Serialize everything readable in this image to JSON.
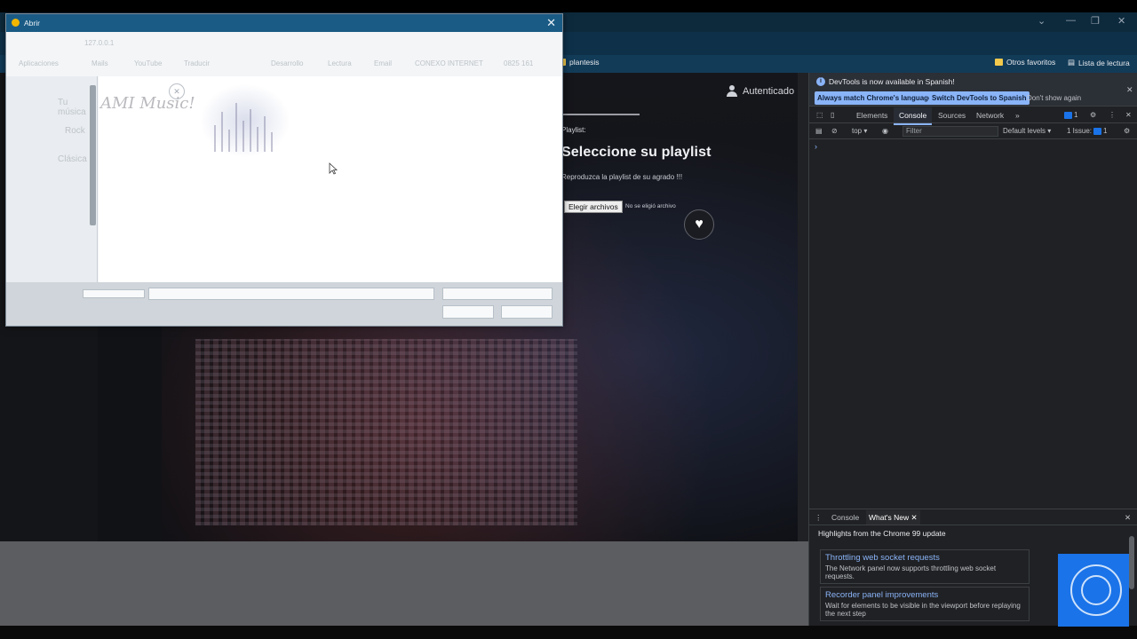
{
  "window": {
    "controls": {
      "minimize": "—",
      "restore": "❐",
      "close": "✕",
      "tab_search": "⌄"
    }
  },
  "bookmarks": {
    "items": [
      {
        "label": "Aplicaciones"
      },
      {
        "label": "Mails"
      },
      {
        "label": "YouTube"
      },
      {
        "label": "Traducir"
      },
      {
        "label": "Desarrollo"
      },
      {
        "label": "Lectura"
      },
      {
        "label": "Email"
      },
      {
        "label": "CONEXO INTERNET"
      },
      {
        "label": "0825 161"
      },
      {
        "label": "plantesis"
      }
    ],
    "right_items": [
      {
        "label": "Otros favoritos"
      },
      {
        "label": "Lista de lectura"
      }
    ]
  },
  "address_bar": {
    "url_text": "127.0.0.1"
  },
  "page": {
    "auth_label": "Autenticado",
    "playlist_label": "Playlist:",
    "title": "Seleccione su playlist",
    "subtitle": "Reproduzca la playlist de su agrado !!!",
    "file_button": "Elegir archivos",
    "file_status": "No se eligió archivo",
    "heart_glyph": "♥"
  },
  "dialog": {
    "title": "Abrir",
    "close_glyph": "✕",
    "logo_text": "AMI Music!",
    "ghost_sidebar": [
      "Tu música",
      "Rock",
      "Clásica"
    ]
  },
  "devtools": {
    "info_text": "DevTools is now available in Spanish!",
    "btn_match": "Always match Chrome's language",
    "btn_switch": "Switch DevTools to Spanish",
    "btn_dont": "Don't show again",
    "tabs": [
      "Elements",
      "Console",
      "Sources",
      "Network"
    ],
    "active_tab": "Console",
    "issues_count": "1",
    "context": "top",
    "filter_placeholder": "Filter",
    "levels": "Default levels",
    "issue_label": "1 Issue:",
    "issue_count2": "1",
    "prompt": "›",
    "drawer_tabs": [
      "Console",
      "What's New"
    ],
    "drawer_heading": "Highlights from the Chrome 99 update",
    "cards": [
      {
        "title": "Throttling web socket requests",
        "desc": "The Network panel now supports throttling web socket requests."
      },
      {
        "title": "Recorder panel improvements",
        "desc": "Wait for elements to be visible in the viewport before replaying the next step"
      }
    ]
  },
  "colors": {
    "chrome_titlebar": "#0d2a3d",
    "devtools_accent": "#8ab4f8",
    "dialog_titlebar": "#1a5b85"
  }
}
